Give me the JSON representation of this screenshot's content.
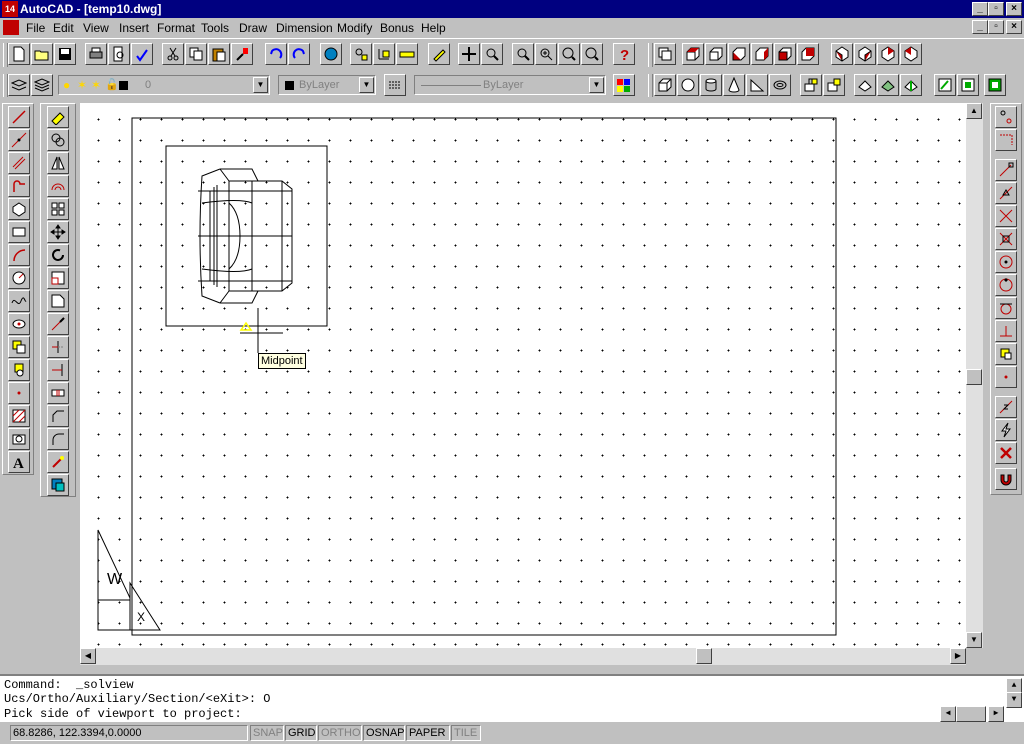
{
  "window": {
    "title": "AutoCAD - [temp10.dwg]",
    "app_icon_text": "14"
  },
  "menu": [
    "File",
    "Edit",
    "View",
    "Insert",
    "Format",
    "Tools",
    "Draw",
    "Dimension",
    "Modify",
    "Bonus",
    "Help"
  ],
  "properties_bar": {
    "layer_value": "0",
    "color_value": "ByLayer",
    "linetype_value": "ByLayer"
  },
  "tooltip": {
    "text": "Midpoint"
  },
  "command_lines": [
    "Command:  _solview",
    "Ucs/Ortho/Auxiliary/Section/<eXit>: O",
    "Pick side of viewport to project:"
  ],
  "status": {
    "coordinates": "68.8286, 122.3394,0.0000",
    "toggles": [
      {
        "label": "SNAP",
        "active": false
      },
      {
        "label": "GRID",
        "active": true
      },
      {
        "label": "ORTHO",
        "active": false
      },
      {
        "label": "OSNAP",
        "active": true
      },
      {
        "label": "PAPER",
        "active": true
      },
      {
        "label": "TILE",
        "active": false
      }
    ]
  },
  "ucs_icon": {
    "labels": [
      "W",
      "X"
    ]
  },
  "colors": {
    "titlebar": "#000080",
    "face": "#c0c0c0",
    "tooltip": "#ffffe1",
    "snap_marker": "#ffff00"
  }
}
